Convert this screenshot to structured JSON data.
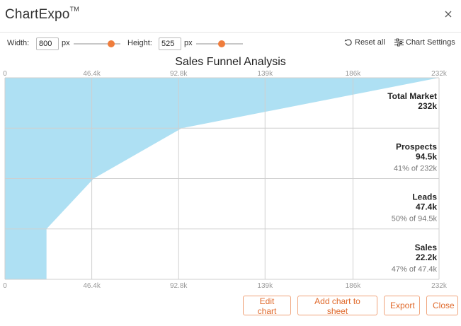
{
  "window": {
    "app_name": "ChartExpo",
    "trademark": "TM"
  },
  "toolbar": {
    "width_label": "Width:",
    "width_value": "800",
    "width_unit": "px",
    "width_slider": 0.81,
    "height_label": "Height:",
    "height_value": "525",
    "height_unit": "px",
    "height_slider": 0.55,
    "reset_label": "Reset all",
    "settings_label": "Chart Settings"
  },
  "chart_data": {
    "type": "funnel",
    "title": "Sales Funnel Analysis",
    "xlim": [
      0,
      232000
    ],
    "ticks": [
      "0",
      "46.4k",
      "92.8k",
      "139k",
      "186k",
      "232k"
    ],
    "tick_values": [
      0,
      46400,
      92800,
      139000,
      186000,
      232000
    ],
    "stages": [
      {
        "name": "Total Market",
        "value": 232000,
        "value_label": "232k",
        "pct_label": ""
      },
      {
        "name": "Prospects",
        "value": 94500,
        "value_label": "94.5k",
        "pct_label": "41% of 232k"
      },
      {
        "name": "Leads",
        "value": 47400,
        "value_label": "47.4k",
        "pct_label": "50% of 94.5k"
      },
      {
        "name": "Sales",
        "value": 22200,
        "value_label": "22.2k",
        "pct_label": "47% of 47.4k"
      }
    ],
    "fill_color": "#aee0f3",
    "grid": true
  },
  "footer": {
    "edit_label": "Edit chart",
    "add_label": "Add chart to sheet",
    "export_label": "Export",
    "close_label": "Close"
  },
  "colors": {
    "accent": "#ef7d3c",
    "button_text": "#e06a2c"
  }
}
